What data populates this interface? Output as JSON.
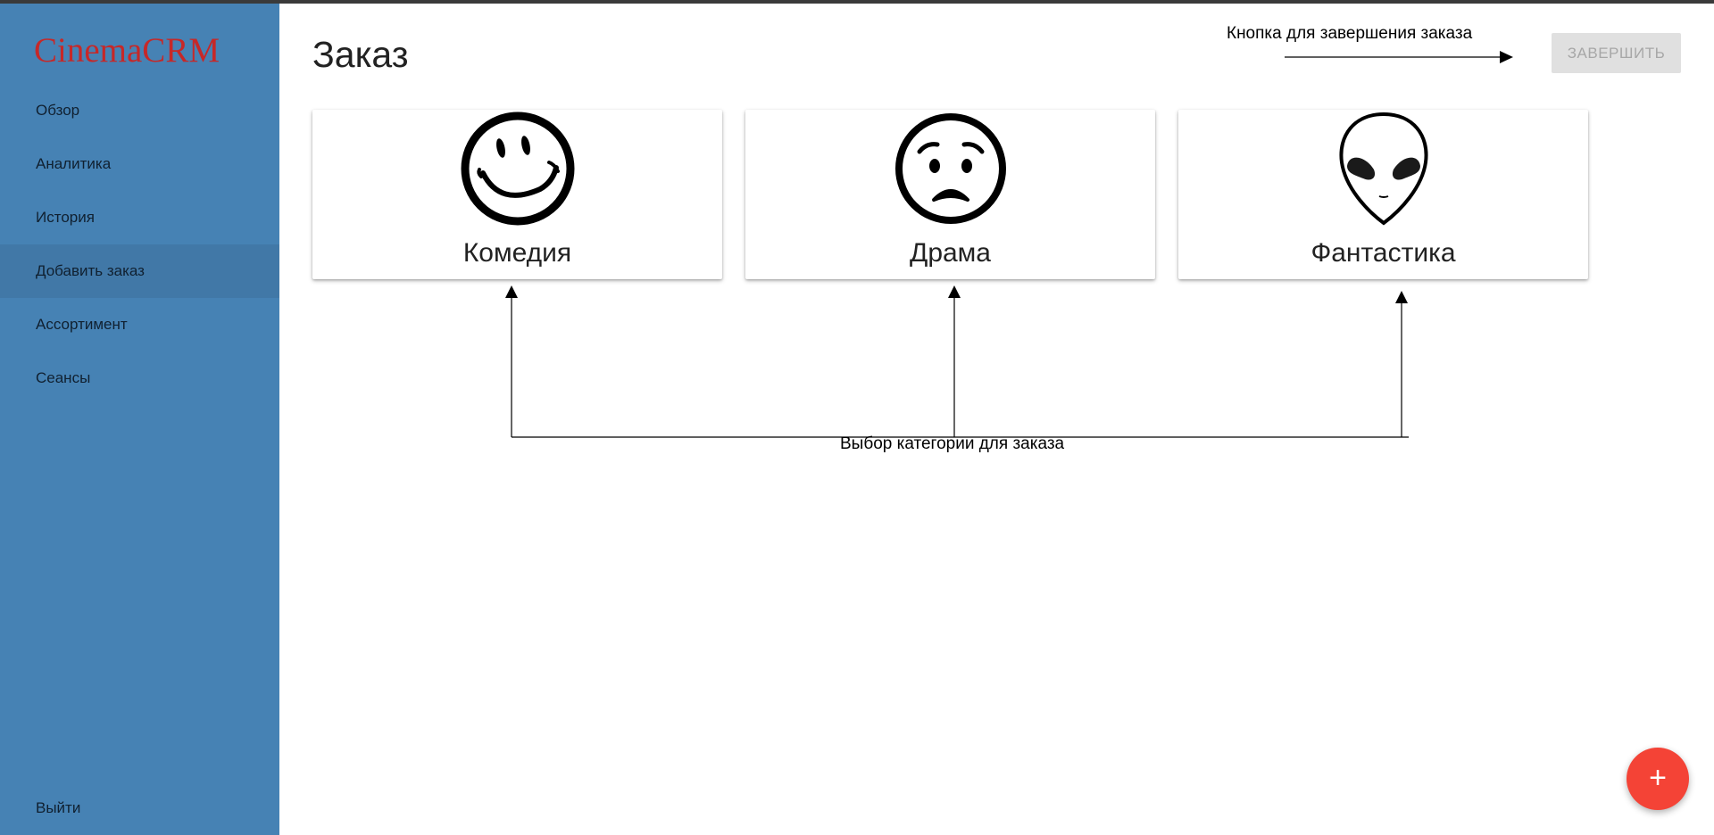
{
  "app": {
    "brand": "CinemaCRM"
  },
  "sidebar": {
    "items": [
      {
        "label": "Обзор"
      },
      {
        "label": "Аналитика"
      },
      {
        "label": "История"
      },
      {
        "label": "Добавить заказ",
        "active": true
      },
      {
        "label": "Ассортимент"
      },
      {
        "label": "Сеансы"
      }
    ],
    "logout_label": "Выйти"
  },
  "main": {
    "title": "Заказ",
    "finish_button_label": "ЗАВЕРШИТЬ",
    "categories": [
      {
        "label": "Комедия",
        "icon": "smiley-face-icon"
      },
      {
        "label": "Драма",
        "icon": "sad-face-icon"
      },
      {
        "label": "Фантастика",
        "icon": "alien-head-icon"
      }
    ],
    "fab_label": "+"
  },
  "annotations": {
    "finish_button_note": "Кнопка для завершения заказа",
    "category_note": "Выбор категории для заказа"
  },
  "colors": {
    "sidebar": "#4682b4",
    "brand": "#c62828",
    "fab": "#f44336",
    "disabled_button": "#e0e0e0"
  }
}
